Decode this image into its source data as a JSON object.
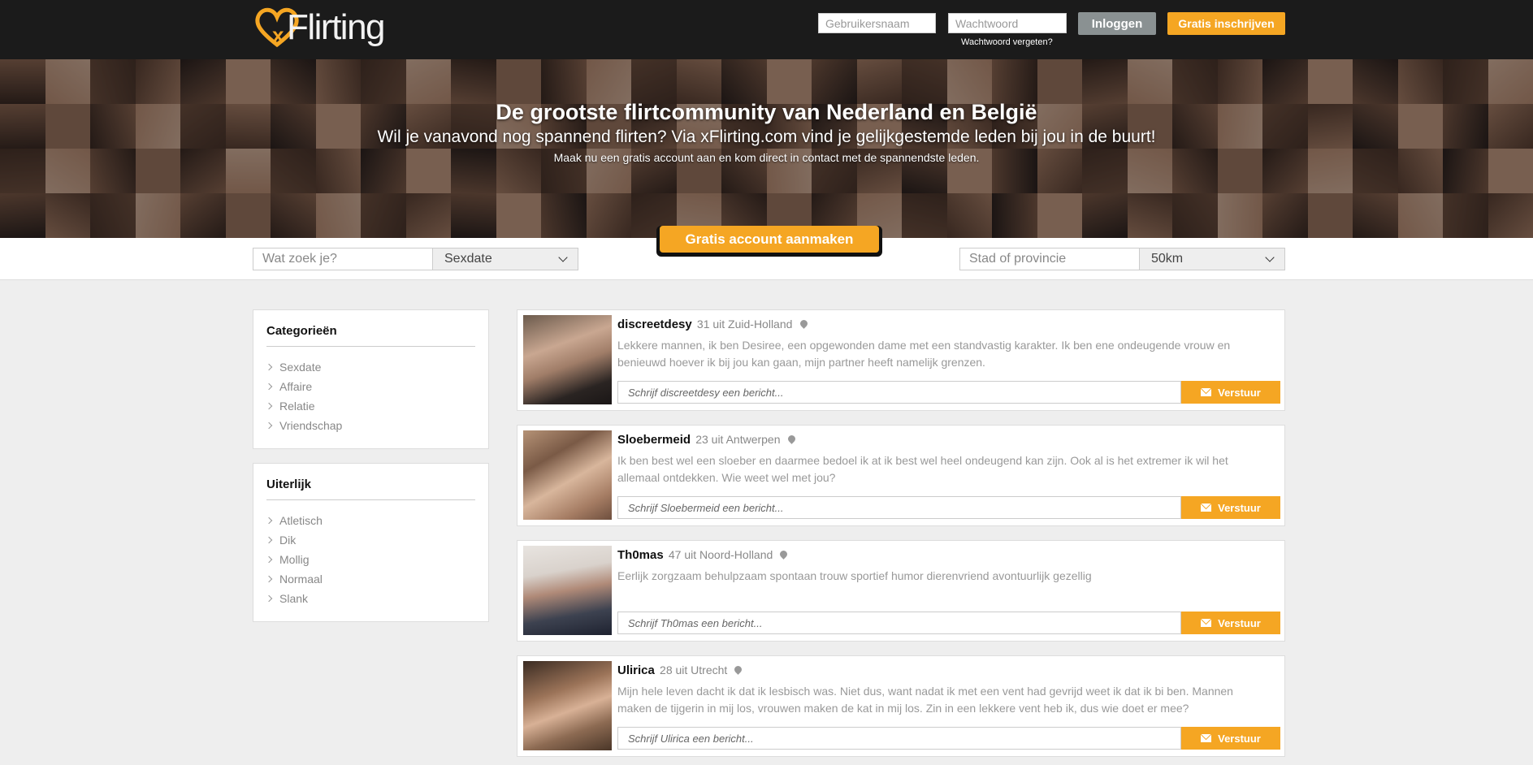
{
  "header": {
    "logo_text": "Flirting",
    "username_placeholder": "Gebruikersnaam",
    "password_placeholder": "Wachtwoord",
    "login_label": "Inloggen",
    "signup_label": "Gratis inschrijven",
    "forgot_label": "Wachtwoord vergeten?"
  },
  "hero": {
    "title": "De grootste flirtcommunity van Nederland en België",
    "subtitle": "Wil je vanavond nog spannend flirten? Via xFlirting.com vind je gelijkgestemde leden bij jou in de buurt!",
    "subtext": "Maak nu een gratis account aan en kom direct in contact met de spannendste leden.",
    "cta_label": "Gratis account aanmaken"
  },
  "search": {
    "query_placeholder": "Wat zoek je?",
    "category_value": "Sexdate",
    "location_placeholder": "Stad of provincie",
    "distance_value": "50km"
  },
  "sidebar": {
    "categories_title": "Categorieën",
    "categories": [
      "Sexdate",
      "Affaire",
      "Relatie",
      "Vriendschap"
    ],
    "appearance_title": "Uiterlijk",
    "appearance": [
      "Atletisch",
      "Dik",
      "Mollig",
      "Normaal",
      "Slank"
    ]
  },
  "profiles": [
    {
      "name": "discreetdesy",
      "meta": "31 uit Zuid-Holland",
      "description": "Lekkere mannen, ik ben Desiree, een opgewonden dame met een standvastig karakter. Ik ben ene ondeugende vrouw en benieuwd hoever ik bij jou kan gaan, mijn partner heeft namelijk grenzen.",
      "message_placeholder": "Schrijf discreetdesy een bericht...",
      "send_label": "Verstuur"
    },
    {
      "name": "Sloebermeid",
      "meta": "23 uit Antwerpen",
      "description": "Ik ben best wel een sloeber en daarmee bedoel ik at ik best wel heel ondeugend kan zijn. Ook al is het extremer ik wil het allemaal ontdekken. Wie weet wel met jou?",
      "message_placeholder": "Schrijf Sloebermeid een bericht...",
      "send_label": "Verstuur"
    },
    {
      "name": "Th0mas",
      "meta": "47 uit Noord-Holland",
      "description": "Eerlijk zorgzaam behulpzaam spontaan trouw sportief humor dierenvriend avontuurlijk gezellig",
      "message_placeholder": "Schrijf Th0mas een bericht...",
      "send_label": "Verstuur"
    },
    {
      "name": "Ulirica",
      "meta": "28 uit Utrecht",
      "description": "Mijn hele leven dacht ik dat ik lesbisch was. Niet dus, want nadat ik met een vent had gevrijd weet ik dat ik bi ben. Mannen maken de tijgerin in mij los, vrouwen maken de kat in mij los. Zin in een lekkere vent heb ik, dus wie doet er mee?",
      "message_placeholder": "Schrijf Ulirica een bericht...",
      "send_label": "Verstuur"
    }
  ],
  "colors": {
    "accent": "#f5a623",
    "header_bg": "#1b1b1b",
    "login_button": "#8a9192"
  }
}
